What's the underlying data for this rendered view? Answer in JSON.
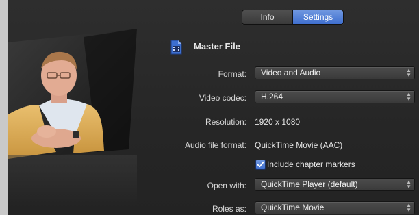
{
  "tabs": [
    {
      "label": "Info",
      "active": false
    },
    {
      "label": "Settings",
      "active": true
    }
  ],
  "section_title": "Master File",
  "fields": {
    "format": {
      "label": "Format:",
      "value": "Video and Audio"
    },
    "video_codec": {
      "label": "Video codec:",
      "value": "H.264"
    },
    "resolution": {
      "label": "Resolution:",
      "value": "1920 x 1080"
    },
    "audio_file_format": {
      "label": "Audio file format:",
      "value": "QuickTime Movie (AAC)"
    },
    "chapter_markers": {
      "label": "Include chapter markers",
      "checked": true
    },
    "open_with": {
      "label": "Open with:",
      "value": "QuickTime Player (default)"
    },
    "roles_as": {
      "label": "Roles as:",
      "value": "QuickTime Movie"
    }
  },
  "colors": {
    "accent": "#4a78d8",
    "panel_bg": "#2a2a2a",
    "outer_bg": "#c9c9c9"
  },
  "icons": {
    "file": "film-document-icon",
    "popup": "updown-chevron-icon",
    "checkbox": "checkmark-icon"
  }
}
